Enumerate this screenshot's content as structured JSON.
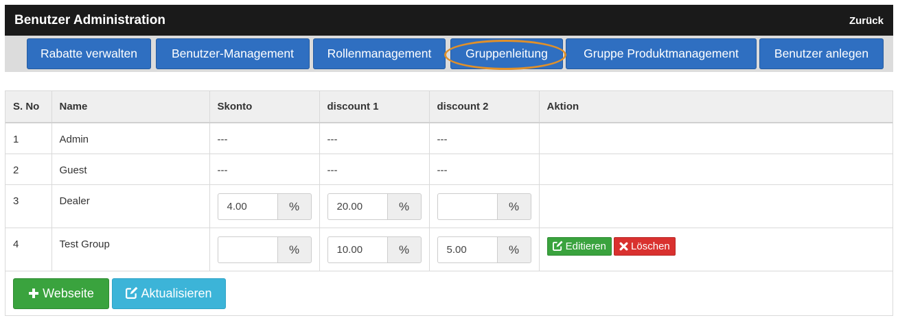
{
  "header": {
    "title": "Benutzer Administration",
    "back_label": "Zurück"
  },
  "nav": {
    "items": [
      {
        "label": "Rabatte verwalten"
      },
      {
        "label": "Benutzer-Management"
      },
      {
        "label": "Rollenmanagement"
      },
      {
        "label": "Gruppenleitung",
        "highlighted": true
      },
      {
        "label": "Gruppe Produktmanagement"
      },
      {
        "label": "Benutzer anlegen"
      }
    ],
    "highlight_color": "#e0902a",
    "button_color": "#2f6fc1"
  },
  "table": {
    "columns": [
      "S. No",
      "Name",
      "Skonto",
      "discount 1",
      "discount 2",
      "Aktion"
    ],
    "percent_symbol": "%",
    "rows": [
      {
        "sno": "1",
        "name": "Admin",
        "skonto": "---",
        "discount1": "---",
        "discount2": "---"
      },
      {
        "sno": "2",
        "name": "Guest",
        "skonto": "---",
        "discount1": "---",
        "discount2": "---"
      },
      {
        "sno": "3",
        "name": "Dealer",
        "skonto": "4.00",
        "discount1": "20.00",
        "discount2": ""
      },
      {
        "sno": "4",
        "name": "Test Group",
        "skonto": "",
        "discount1": "10.00",
        "discount2": "5.00",
        "edit_label": "Editieren",
        "delete_label": "Löschen"
      }
    ]
  },
  "footer": {
    "website_label": "Webseite",
    "update_label": "Aktualisieren"
  },
  "colors": {
    "success": "#3aa33e",
    "danger": "#d9312f",
    "info": "#3cb4d8"
  }
}
